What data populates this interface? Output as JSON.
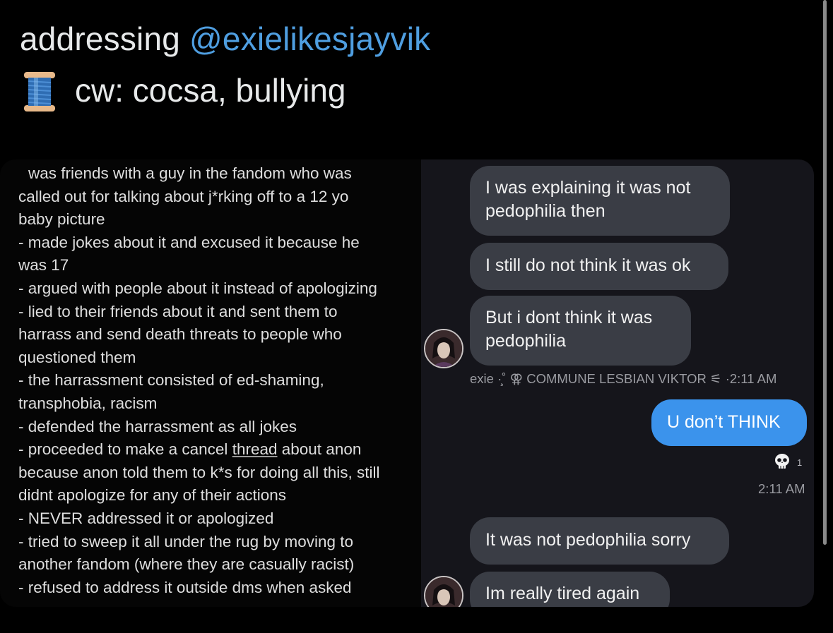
{
  "header": {
    "prefix": "addressing ",
    "mention": "@exielikesjayvik",
    "cw_text": "cw: cocsa, bullying",
    "cw_icon": "spool-of-thread-icon"
  },
  "notes": {
    "lines": [
      "was friends with a guy in the fandom who was",
      "called out for talking about j*rking off to a 12 yo",
      "baby picture",
      "- made jokes about it and excused it because he",
      "was 17",
      "- argued with people about it instead of apologizing",
      "- lied to their friends about it and sent them to",
      "harrass and send death threats to people who",
      "questioned them",
      "- the harrassment consisted of ed-shaming,",
      "transphobia, racism",
      "- defended the harrassment as all jokes",
      "- proceeded to make a cancel ",
      "because anon told them to k*s for doing all this, still",
      "didnt apologize for any of their actions",
      "- NEVER addressed it or apologized",
      "- tried to sweep it all under the rug by moving to",
      "another fandom (where they are casually racist)",
      "- refused to address it outside dms when asked"
    ],
    "line12_underlined": "thread",
    "line12_tail": " about anon"
  },
  "chat": {
    "bubble1_line1": "I was explaining it was not",
    "bubble1_line2": "pedophilia then",
    "bubble2": "I still do not think it was ok",
    "bubble3_line1": "But i dont think it was",
    "bubble3_line2": "pedophilia",
    "sender_meta": "exie ·̧˚ ⚢ COMMUNE LESBIAN VIKTOR ⚟ ·2:11 AM",
    "sent_bubble": "U don’t THINK",
    "reaction_icon": "skull-icon",
    "reaction_count": "1",
    "sent_time": "2:11 AM",
    "bubble4": "It was not pedophilia sorry",
    "bubble5": "Im really tired again",
    "colors": {
      "received_bubble": "#3a3d45",
      "sent_bubble": "#3b93ec",
      "panel_bg": "#15151b"
    }
  }
}
